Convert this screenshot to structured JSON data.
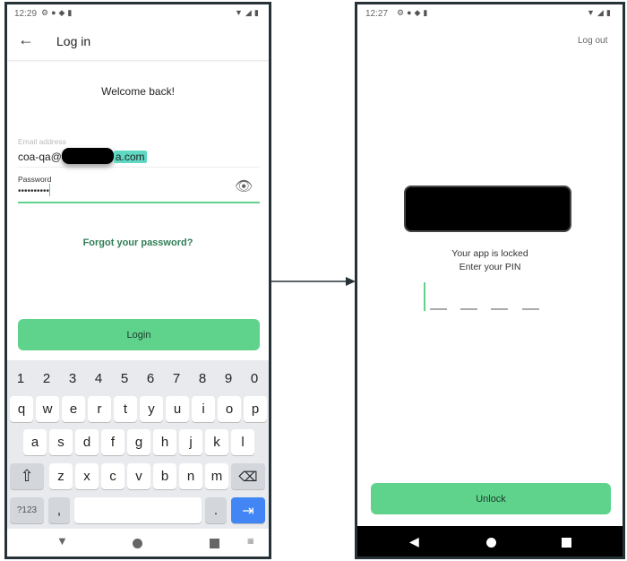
{
  "login_screen": {
    "status_time": "12:29",
    "title": "Log in",
    "welcome": "Welcome back!",
    "email_label": "Email address",
    "email_value_prefix": "coa-qa@",
    "email_value_suffix": "a.com",
    "password_label": "Password",
    "password_value": "••••••••••",
    "forgot": "Forgot your password?",
    "login_button": "Login",
    "keyboard": {
      "numbers": [
        "1",
        "2",
        "3",
        "4",
        "5",
        "6",
        "7",
        "8",
        "9",
        "0"
      ],
      "row1": [
        "q",
        "w",
        "e",
        "r",
        "t",
        "y",
        "u",
        "i",
        "o",
        "p"
      ],
      "row2": [
        "a",
        "s",
        "d",
        "f",
        "g",
        "h",
        "j",
        "k",
        "l"
      ],
      "row3": [
        "z",
        "x",
        "c",
        "v",
        "b",
        "n",
        "m"
      ],
      "symbols_key": "?123",
      "comma_key": ",",
      "period_key": ".",
      "shift_icon": "⇧",
      "backspace_icon": "⌫",
      "enter_icon": "⇥"
    }
  },
  "lock_screen": {
    "status_time": "12:27",
    "logout": "Log out",
    "locked_text": "Your app is locked",
    "pin_prompt": "Enter your PIN",
    "unlock_button": "Unlock"
  },
  "colors": {
    "accent": "#5fd38c",
    "frame": "#263238",
    "enter_key": "#4285f4",
    "email_highlight": "#5fd9c4"
  }
}
